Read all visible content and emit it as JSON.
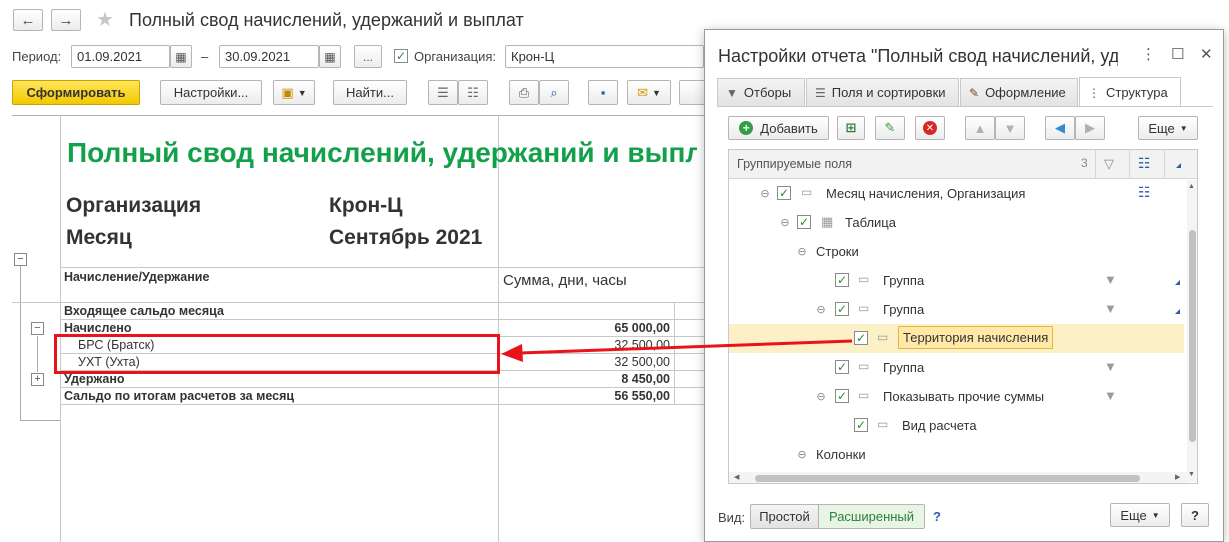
{
  "window": {
    "title": "Полный свод начислений, удержаний и выплат",
    "back_label": "←",
    "forward_label": "→"
  },
  "params": {
    "period_label": "Период:",
    "date_from": "01.09.2021",
    "dash": "–",
    "date_to": "30.09.2021",
    "more_label": "...",
    "org_checked": true,
    "org_label": "Организация:",
    "org_value": "Крон-Ц"
  },
  "toolbar": {
    "generate_label": "Сформировать",
    "settings_label": "Настройки...",
    "find_label": "Найти..."
  },
  "report": {
    "title": "Полный свод начислений, удержаний и выплат",
    "org_caption": "Организация",
    "org_value": "Крон-Ц",
    "month_caption": "Месяц",
    "month_value": "Сентябрь 2021",
    "col_accrual": "Начисление/Удержание",
    "col_sum": "Сумма, дни, часы",
    "rows": [
      {
        "label": "Входящее сальдо месяца",
        "amount": ""
      },
      {
        "label": "Начислено",
        "amount": "65 000,00"
      },
      {
        "label": "БРС (Братск)",
        "amount": "32 500,00"
      },
      {
        "label": "УХТ (Ухта)",
        "amount": "32 500,00"
      },
      {
        "label": "Удержано",
        "amount": "8 450,00"
      },
      {
        "label": "Сальдо по итогам расчетов за месяц",
        "amount": "56 550,00"
      }
    ]
  },
  "dialog": {
    "title": "Настройки отчета \"Полный свод начислений, удержаний и выплат\"",
    "more_icon": "⋮",
    "maximize_icon": "☐",
    "close_icon": "✕",
    "tabs": [
      {
        "label": "Отборы",
        "icon": "filter-icon"
      },
      {
        "label": "Поля и сортировки",
        "icon": "fields-icon"
      },
      {
        "label": "Оформление",
        "icon": "brush-icon"
      },
      {
        "label": "Структура",
        "icon": "structure-icon",
        "active": true
      }
    ],
    "add_label": "Добавить",
    "more_label": "Еще",
    "tree_header": "Группируемые поля",
    "tree_items": [
      {
        "label": "Месяц начисления, Организация",
        "checked": true
      },
      {
        "label": "Таблица",
        "checked": true
      },
      {
        "label": "Строки"
      },
      {
        "label": "Группа",
        "checked": true
      },
      {
        "label": "Группа",
        "checked": true
      },
      {
        "label": "Территория начисления",
        "checked": true,
        "selected": true
      },
      {
        "label": "Группа",
        "checked": true
      },
      {
        "label": "Показывать прочие суммы",
        "checked": true
      },
      {
        "label": "Вид расчета",
        "checked": true
      },
      {
        "label": "Колонки"
      }
    ],
    "view_label": "Вид:",
    "view_simple": "Простой",
    "view_extended": "Расширенный",
    "help_label": "?",
    "footer_more_label": "Еще",
    "footer_help_label": "?"
  },
  "colors": {
    "title_green": "#13a04b",
    "highlight_red": "#e8141a",
    "primary_yellow": "#f3c800",
    "selected_row": "#fbf0c6"
  }
}
